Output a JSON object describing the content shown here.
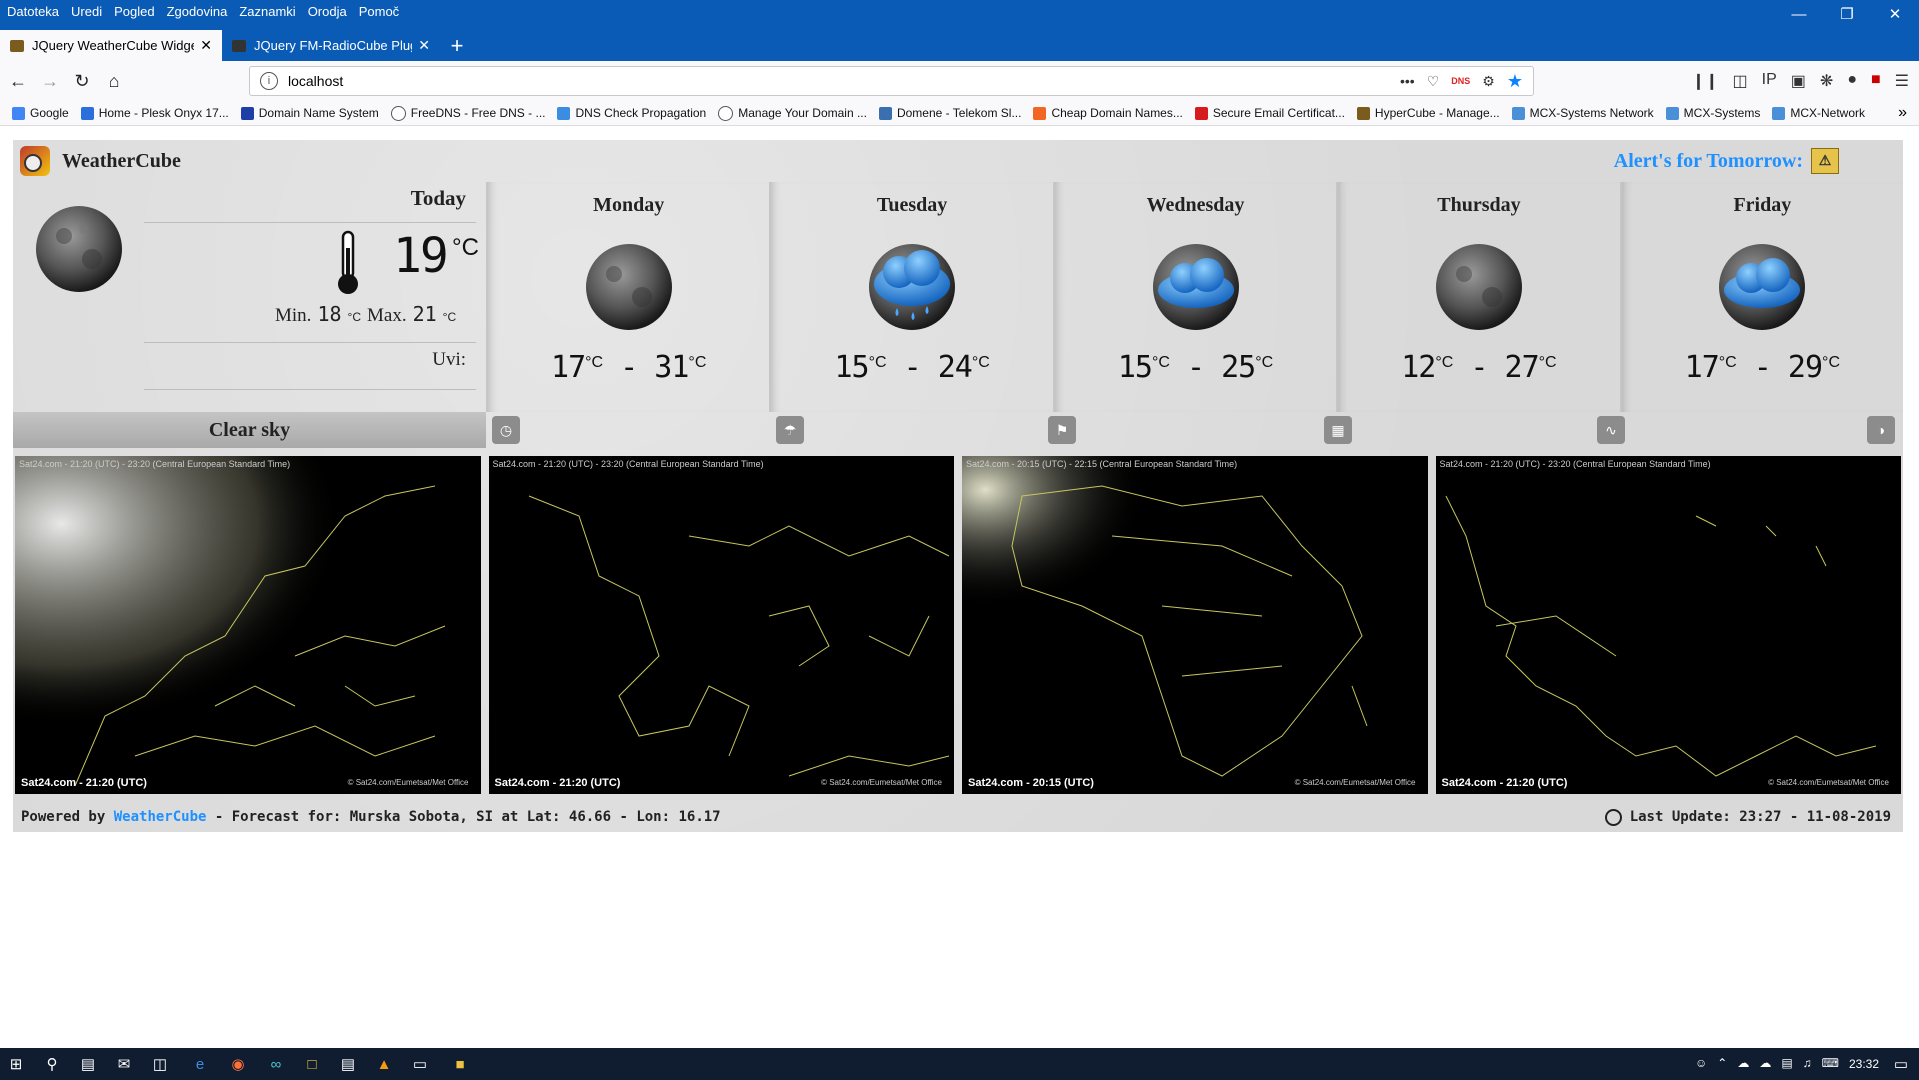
{
  "browser": {
    "menu": [
      "Datoteka",
      "Uredi",
      "Pogled",
      "Zgodovina",
      "Zaznamki",
      "Orodja",
      "Pomoč"
    ],
    "tabs": [
      {
        "label": "JQuery WeatherCube Widget",
        "active": true
      },
      {
        "label": "JQuery FM-RadioCube Plugin",
        "active": false
      }
    ],
    "url": "localhost",
    "dns_badge": "DNS",
    "bookmarks": [
      {
        "label": "Google",
        "color": "#4285f4"
      },
      {
        "label": "Home - Plesk Onyx 17...",
        "color": "#2a6fdb"
      },
      {
        "label": "Domain Name System",
        "color": "#1f3fa8"
      },
      {
        "label": "FreeDNS - Free DNS - ...",
        "color": "#555"
      },
      {
        "label": "DNS Check Propagation",
        "color": "#3a8de0"
      },
      {
        "label": "Manage Your Domain ...",
        "color": "#555"
      },
      {
        "label": "Domene - Telekom Sl...",
        "color": "#3a6fb0"
      },
      {
        "label": "Cheap Domain Names...",
        "color": "#f26522"
      },
      {
        "label": "Secure Email Certificat...",
        "color": "#d71920"
      },
      {
        "label": "HyperCube - Manage...",
        "color": "#7a5c1e"
      },
      {
        "label": "MCX-Systems Network",
        "color": "#4a90d9"
      },
      {
        "label": "MCX-Systems",
        "color": "#4a90d9"
      },
      {
        "label": "MCX-Network",
        "color": "#4a90d9"
      }
    ]
  },
  "widget": {
    "brand": "WeatherCube",
    "alert_label": "Alert's for Tomorrow:",
    "today": {
      "label": "Today",
      "temp": "19",
      "unit": "°C",
      "min_label": "Min.",
      "min": "18",
      "max_label": "Max.",
      "max": "21",
      "uvi_label": "Uvi:",
      "condition": "Clear sky"
    },
    "days": [
      {
        "name": "Monday",
        "icon": "moon-icon",
        "min": "17",
        "max": "31"
      },
      {
        "name": "Tuesday",
        "icon": "rain-cloud-icon",
        "min": "15",
        "max": "24"
      },
      {
        "name": "Wednesday",
        "icon": "cloud-moon-icon",
        "min": "15",
        "max": "25"
      },
      {
        "name": "Thursday",
        "icon": "moon-icon",
        "min": "12",
        "max": "27"
      },
      {
        "name": "Friday",
        "icon": "cloud-moon-icon",
        "min": "17",
        "max": "29"
      }
    ],
    "unit": "°C",
    "dash": "-",
    "toolbar_icons": [
      "clock-icon",
      "umbrella-icon",
      "flag-icon",
      "calculator-icon",
      "pulse-icon",
      "contrast-icon"
    ],
    "maps": [
      {
        "top": "Sat24.com - 21:20 (UTC) - 23:20 (Central European Standard Time)",
        "bottom": "Sat24.com - 21:20 (UTC)",
        "credit": "© Sat24.com/Eumetsat/Met Office"
      },
      {
        "top": "Sat24.com - 21:20 (UTC) - 23:20 (Central European Standard Time)",
        "bottom": "Sat24.com - 21:20 (UTC)",
        "credit": "© Sat24.com/Eumetsat/Met Office"
      },
      {
        "top": "Sat24.com - 20:15 (UTC) - 22:15 (Central European Standard Time)",
        "bottom": "Sat24.com - 20:15 (UTC)",
        "credit": "© Sat24.com/Eumetsat/Met Office"
      },
      {
        "top": "Sat24.com - 21:20 (UTC) - 23:20 (Central European Standard Time)",
        "bottom": "Sat24.com - 21:20 (UTC)",
        "credit": "© Sat24.com/Eumetsat/Met Office"
      }
    ],
    "footer": {
      "powered": "Powered by",
      "brand": "WeatherCube",
      "forecast": "- Forecast for: Murska Sobota, SI at Lat: 46.66 - Lon: 16.17",
      "last_update": "Last Update: 23:27 - 11-08-2019"
    }
  },
  "taskbar": {
    "clock": "23:32"
  },
  "colors": {
    "titlebar": "#0a5bb5",
    "accent_link": "#1e90ff",
    "taskbar": "#101d31"
  }
}
